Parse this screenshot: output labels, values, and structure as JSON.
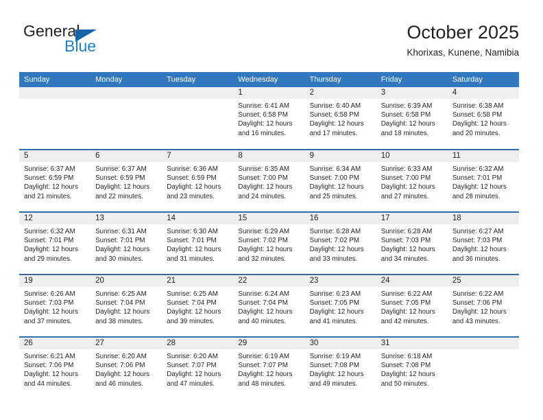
{
  "brand": {
    "name_part1": "General",
    "name_part2": "Blue",
    "logo_icon": "triangle-logo-icon"
  },
  "header": {
    "title": "October 2025",
    "location": "Khorixas, Kunene, Namibia"
  },
  "colors": {
    "header_blue": "#3278be",
    "week_divider_blue": "#2e6da9",
    "daynum_band": "#eeeeee",
    "text": "#231f20",
    "brand_blue": "#1f7fc4"
  },
  "calendar": {
    "weekday_headers": [
      "Sunday",
      "Monday",
      "Tuesday",
      "Wednesday",
      "Thursday",
      "Friday",
      "Saturday"
    ],
    "weeks": [
      [
        {
          "day": "",
          "sunrise": "",
          "sunset": "",
          "daylight_line1": "",
          "daylight_line2": ""
        },
        {
          "day": "",
          "sunrise": "",
          "sunset": "",
          "daylight_line1": "",
          "daylight_line2": ""
        },
        {
          "day": "",
          "sunrise": "",
          "sunset": "",
          "daylight_line1": "",
          "daylight_line2": ""
        },
        {
          "day": "1",
          "sunrise": "Sunrise: 6:41 AM",
          "sunset": "Sunset: 6:58 PM",
          "daylight_line1": "Daylight: 12 hours",
          "daylight_line2": "and 16 minutes."
        },
        {
          "day": "2",
          "sunrise": "Sunrise: 6:40 AM",
          "sunset": "Sunset: 6:58 PM",
          "daylight_line1": "Daylight: 12 hours",
          "daylight_line2": "and 17 minutes."
        },
        {
          "day": "3",
          "sunrise": "Sunrise: 6:39 AM",
          "sunset": "Sunset: 6:58 PM",
          "daylight_line1": "Daylight: 12 hours",
          "daylight_line2": "and 18 minutes."
        },
        {
          "day": "4",
          "sunrise": "Sunrise: 6:38 AM",
          "sunset": "Sunset: 6:58 PM",
          "daylight_line1": "Daylight: 12 hours",
          "daylight_line2": "and 20 minutes."
        }
      ],
      [
        {
          "day": "5",
          "sunrise": "Sunrise: 6:37 AM",
          "sunset": "Sunset: 6:59 PM",
          "daylight_line1": "Daylight: 12 hours",
          "daylight_line2": "and 21 minutes."
        },
        {
          "day": "6",
          "sunrise": "Sunrise: 6:37 AM",
          "sunset": "Sunset: 6:59 PM",
          "daylight_line1": "Daylight: 12 hours",
          "daylight_line2": "and 22 minutes."
        },
        {
          "day": "7",
          "sunrise": "Sunrise: 6:36 AM",
          "sunset": "Sunset: 6:59 PM",
          "daylight_line1": "Daylight: 12 hours",
          "daylight_line2": "and 23 minutes."
        },
        {
          "day": "8",
          "sunrise": "Sunrise: 6:35 AM",
          "sunset": "Sunset: 7:00 PM",
          "daylight_line1": "Daylight: 12 hours",
          "daylight_line2": "and 24 minutes."
        },
        {
          "day": "9",
          "sunrise": "Sunrise: 6:34 AM",
          "sunset": "Sunset: 7:00 PM",
          "daylight_line1": "Daylight: 12 hours",
          "daylight_line2": "and 25 minutes."
        },
        {
          "day": "10",
          "sunrise": "Sunrise: 6:33 AM",
          "sunset": "Sunset: 7:00 PM",
          "daylight_line1": "Daylight: 12 hours",
          "daylight_line2": "and 27 minutes."
        },
        {
          "day": "11",
          "sunrise": "Sunrise: 6:32 AM",
          "sunset": "Sunset: 7:01 PM",
          "daylight_line1": "Daylight: 12 hours",
          "daylight_line2": "and 28 minutes."
        }
      ],
      [
        {
          "day": "12",
          "sunrise": "Sunrise: 6:32 AM",
          "sunset": "Sunset: 7:01 PM",
          "daylight_line1": "Daylight: 12 hours",
          "daylight_line2": "and 29 minutes."
        },
        {
          "day": "13",
          "sunrise": "Sunrise: 6:31 AM",
          "sunset": "Sunset: 7:01 PM",
          "daylight_line1": "Daylight: 12 hours",
          "daylight_line2": "and 30 minutes."
        },
        {
          "day": "14",
          "sunrise": "Sunrise: 6:30 AM",
          "sunset": "Sunset: 7:01 PM",
          "daylight_line1": "Daylight: 12 hours",
          "daylight_line2": "and 31 minutes."
        },
        {
          "day": "15",
          "sunrise": "Sunrise: 6:29 AM",
          "sunset": "Sunset: 7:02 PM",
          "daylight_line1": "Daylight: 12 hours",
          "daylight_line2": "and 32 minutes."
        },
        {
          "day": "16",
          "sunrise": "Sunrise: 6:28 AM",
          "sunset": "Sunset: 7:02 PM",
          "daylight_line1": "Daylight: 12 hours",
          "daylight_line2": "and 33 minutes."
        },
        {
          "day": "17",
          "sunrise": "Sunrise: 6:28 AM",
          "sunset": "Sunset: 7:03 PM",
          "daylight_line1": "Daylight: 12 hours",
          "daylight_line2": "and 34 minutes."
        },
        {
          "day": "18",
          "sunrise": "Sunrise: 6:27 AM",
          "sunset": "Sunset: 7:03 PM",
          "daylight_line1": "Daylight: 12 hours",
          "daylight_line2": "and 36 minutes."
        }
      ],
      [
        {
          "day": "19",
          "sunrise": "Sunrise: 6:26 AM",
          "sunset": "Sunset: 7:03 PM",
          "daylight_line1": "Daylight: 12 hours",
          "daylight_line2": "and 37 minutes."
        },
        {
          "day": "20",
          "sunrise": "Sunrise: 6:25 AM",
          "sunset": "Sunset: 7:04 PM",
          "daylight_line1": "Daylight: 12 hours",
          "daylight_line2": "and 38 minutes."
        },
        {
          "day": "21",
          "sunrise": "Sunrise: 6:25 AM",
          "sunset": "Sunset: 7:04 PM",
          "daylight_line1": "Daylight: 12 hours",
          "daylight_line2": "and 39 minutes."
        },
        {
          "day": "22",
          "sunrise": "Sunrise: 6:24 AM",
          "sunset": "Sunset: 7:04 PM",
          "daylight_line1": "Daylight: 12 hours",
          "daylight_line2": "and 40 minutes."
        },
        {
          "day": "23",
          "sunrise": "Sunrise: 6:23 AM",
          "sunset": "Sunset: 7:05 PM",
          "daylight_line1": "Daylight: 12 hours",
          "daylight_line2": "and 41 minutes."
        },
        {
          "day": "24",
          "sunrise": "Sunrise: 6:22 AM",
          "sunset": "Sunset: 7:05 PM",
          "daylight_line1": "Daylight: 12 hours",
          "daylight_line2": "and 42 minutes."
        },
        {
          "day": "25",
          "sunrise": "Sunrise: 6:22 AM",
          "sunset": "Sunset: 7:06 PM",
          "daylight_line1": "Daylight: 12 hours",
          "daylight_line2": "and 43 minutes."
        }
      ],
      [
        {
          "day": "26",
          "sunrise": "Sunrise: 6:21 AM",
          "sunset": "Sunset: 7:06 PM",
          "daylight_line1": "Daylight: 12 hours",
          "daylight_line2": "and 44 minutes."
        },
        {
          "day": "27",
          "sunrise": "Sunrise: 6:20 AM",
          "sunset": "Sunset: 7:06 PM",
          "daylight_line1": "Daylight: 12 hours",
          "daylight_line2": "and 46 minutes."
        },
        {
          "day": "28",
          "sunrise": "Sunrise: 6:20 AM",
          "sunset": "Sunset: 7:07 PM",
          "daylight_line1": "Daylight: 12 hours",
          "daylight_line2": "and 47 minutes."
        },
        {
          "day": "29",
          "sunrise": "Sunrise: 6:19 AM",
          "sunset": "Sunset: 7:07 PM",
          "daylight_line1": "Daylight: 12 hours",
          "daylight_line2": "and 48 minutes."
        },
        {
          "day": "30",
          "sunrise": "Sunrise: 6:19 AM",
          "sunset": "Sunset: 7:08 PM",
          "daylight_line1": "Daylight: 12 hours",
          "daylight_line2": "and 49 minutes."
        },
        {
          "day": "31",
          "sunrise": "Sunrise: 6:18 AM",
          "sunset": "Sunset: 7:08 PM",
          "daylight_line1": "Daylight: 12 hours",
          "daylight_line2": "and 50 minutes."
        },
        {
          "day": "",
          "sunrise": "",
          "sunset": "",
          "daylight_line1": "",
          "daylight_line2": ""
        }
      ]
    ]
  }
}
